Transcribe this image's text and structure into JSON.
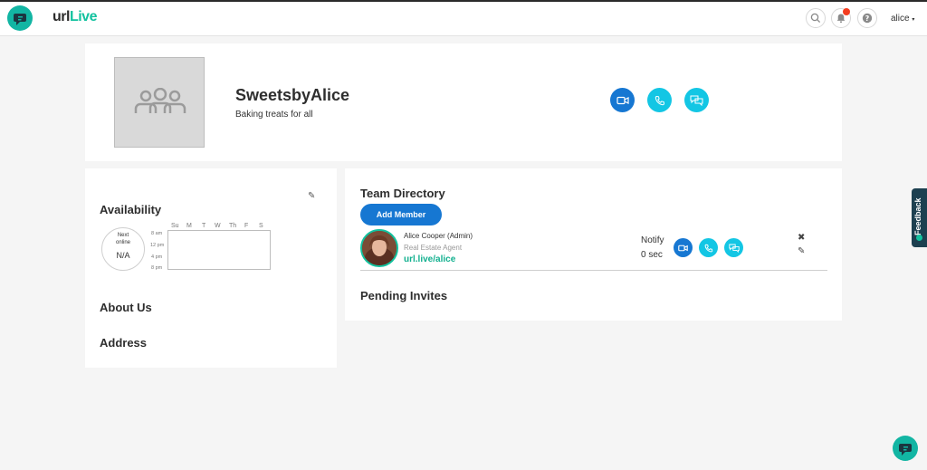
{
  "header": {
    "logo_text_part1": "url",
    "logo_text_part2": "Live",
    "user_menu_label": "alice",
    "user_menu_caret": "▾"
  },
  "icons": {
    "brand": "chat-bubble-icon",
    "search": "search-icon",
    "notifications": "bell-icon",
    "help": "question-icon",
    "video": "video-camera-icon",
    "phone": "phone-icon",
    "chat": "chat-bubbles-icon",
    "edit": "pencil-icon",
    "remove": "close-icon"
  },
  "colors": {
    "brand_teal": "#12b5a3",
    "primary_blue": "#1677d2",
    "cyan": "#13c6e4",
    "link_green": "#12b08f",
    "notification_red": "#f43c1f",
    "feedback_navy": "#1d4050"
  },
  "profile": {
    "name": "SweetsbyAlice",
    "description": "Baking treats for all"
  },
  "availability": {
    "title": "Availability",
    "next_online_label_1": "Next",
    "next_online_label_2": "online",
    "next_online_value": "N/A",
    "days": [
      "Su",
      "M",
      "T",
      "W",
      "Th",
      "F",
      "S"
    ],
    "times": [
      "8 am",
      "12 pm",
      "4 pm",
      "8 pm"
    ]
  },
  "about": {
    "title": "About Us"
  },
  "address": {
    "title": "Address"
  },
  "team": {
    "title": "Team Directory",
    "add_member_label": "Add Member",
    "members": [
      {
        "name": "Alice Cooper (Admin)",
        "role": "Real Estate Agent",
        "url": "url.live/alice",
        "notify_label": "Notify",
        "notify_value": "0 sec"
      }
    ],
    "remove_glyph": "✖",
    "edit_glyph": "✎"
  },
  "pending": {
    "title": "Pending Invites"
  },
  "feedback": {
    "label": "Feedback"
  }
}
